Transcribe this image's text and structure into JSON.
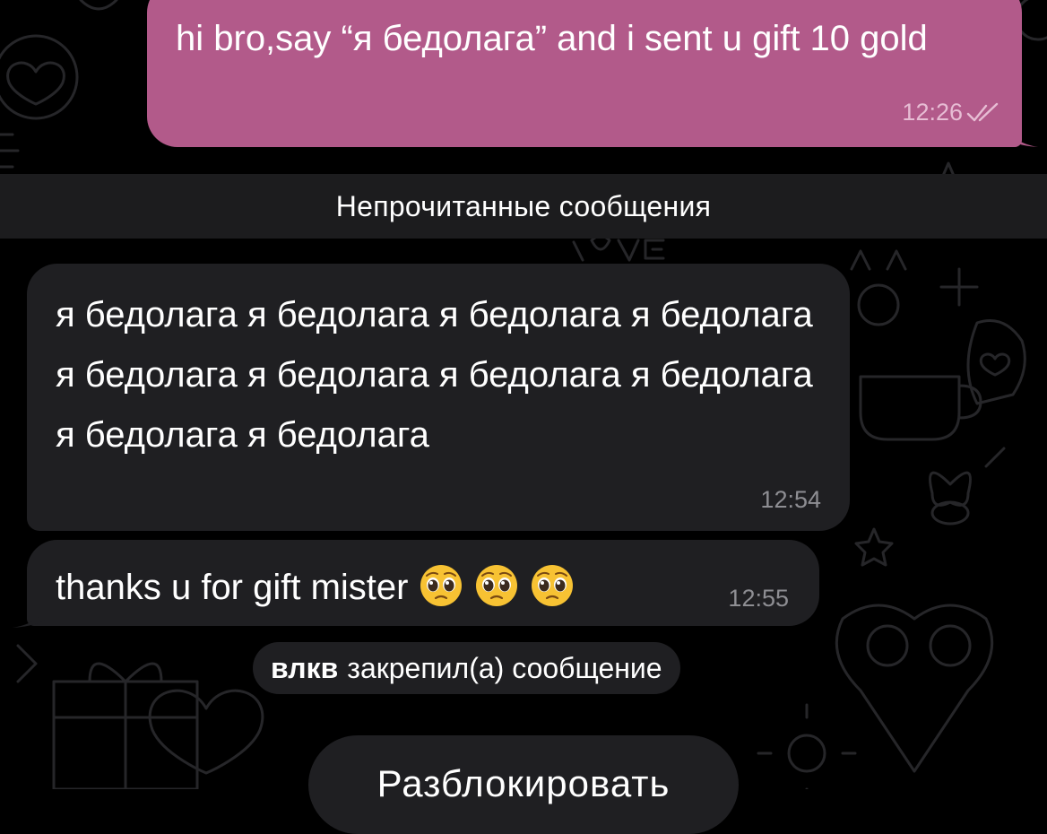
{
  "colors": {
    "background": "#000000",
    "outgoing_bubble": "#b25a8a",
    "incoming_bubble": "#1f1f22",
    "unread_bar": "#1c1c1e",
    "doodle_stroke": "#262629",
    "meta_incoming": "#8e8e93",
    "meta_outgoing": "#e7bdd4"
  },
  "messages": {
    "outgoing": {
      "text": "hi bro,say “я бедолага” and i sent u gift 10 gold",
      "time": "12:26",
      "status_icon": "double-check-icon"
    },
    "incoming_1": {
      "text": "я бедолага я бедолага я бедолага я бедолага я бедолага я бедолага я бедолага я бедолага я бедолага я бедолага",
      "time": "12:54"
    },
    "incoming_2": {
      "text": "thanks u for gift mister",
      "emojis": [
        "pleading-face-icon",
        "pleading-face-icon",
        "pleading-face-icon"
      ],
      "time": "12:55"
    }
  },
  "unread_divider": {
    "label": "Непрочитанные сообщения"
  },
  "service_message": {
    "author": "влкв",
    "action": "закрепил(а) сообщение"
  },
  "bottom_action": {
    "label": "Разблокировать"
  }
}
